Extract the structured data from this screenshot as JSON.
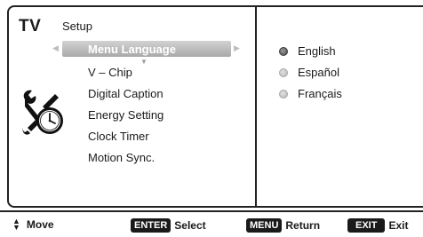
{
  "header": {
    "logo": "TV",
    "section": "Setup"
  },
  "menu": {
    "items": [
      {
        "label": "Menu Language",
        "selected": true
      },
      {
        "label": "V – Chip",
        "selected": false
      },
      {
        "label": "Digital Caption",
        "selected": false
      },
      {
        "label": "Energy Setting",
        "selected": false
      },
      {
        "label": "Clock Timer",
        "selected": false
      },
      {
        "label": "Motion Sync.",
        "selected": false
      }
    ],
    "icon": "wrench-clock-icon"
  },
  "options": [
    {
      "label": "English",
      "checked": true
    },
    {
      "label": "Español",
      "checked": false
    },
    {
      "label": "Français",
      "checked": false
    }
  ],
  "footer": {
    "move_label": "Move",
    "enter_key": "ENTER",
    "enter_label": "Select",
    "menu_key": "MENU",
    "menu_label": "Return",
    "exit_key": "EXIT",
    "exit_label": "Exit"
  }
}
